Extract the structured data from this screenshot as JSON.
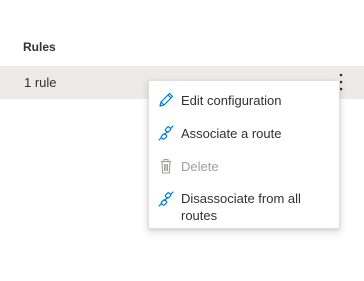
{
  "table": {
    "column_header": "Rules",
    "row": {
      "value": "1 rule",
      "more_icon": "more-vertical-icon"
    }
  },
  "context_menu": {
    "items": [
      {
        "label": "Edit configuration",
        "icon": "pencil-icon",
        "enabled": true
      },
      {
        "label": "Associate a route",
        "icon": "link-icon",
        "enabled": true
      },
      {
        "label": "Delete",
        "icon": "trash-icon",
        "enabled": false
      },
      {
        "label": "Disassociate from all routes",
        "icon": "link-icon",
        "enabled": true
      }
    ]
  },
  "colors": {
    "accent": "#0078d4",
    "disabled": "#a19f9d",
    "row_background": "#edebe9"
  }
}
